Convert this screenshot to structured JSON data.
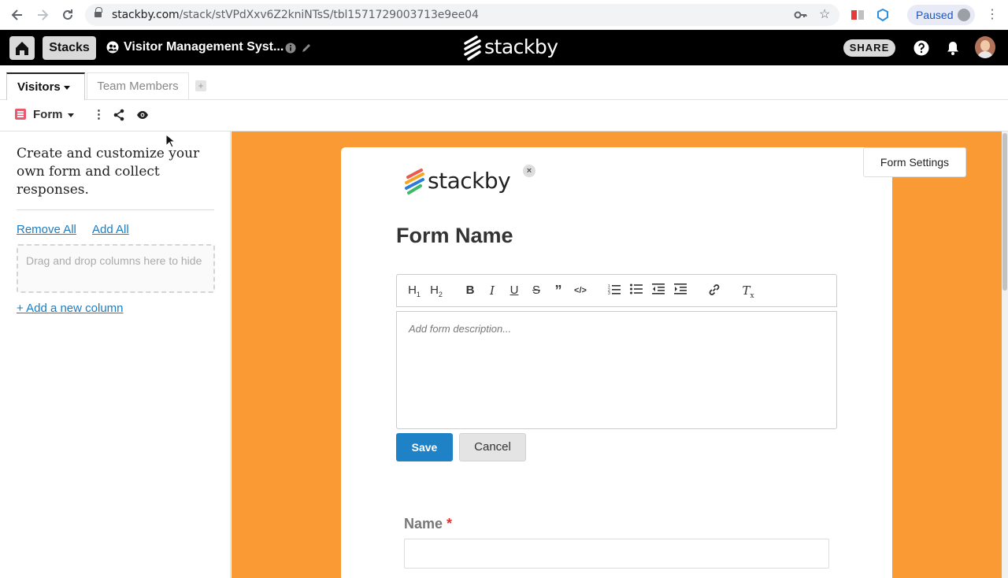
{
  "browser": {
    "url_host": "stackby.com",
    "url_path": "/stack/stVPdXxv6Z2kniNTsS/tbl1571729003713e9ee04",
    "profile_status": "Paused"
  },
  "header": {
    "stacks_label": "Stacks",
    "stack_title": "Visitor Management Syst...",
    "logo_text": "stackby",
    "share_label": "SHARE"
  },
  "tabs": [
    {
      "label": "Visitors",
      "active": true
    },
    {
      "label": "Team Members",
      "active": false
    }
  ],
  "view": {
    "name": "Form"
  },
  "left_panel": {
    "description": "Create and customize your own form and collect responses.",
    "remove_all": "Remove All",
    "add_all": "Add All",
    "dropzone_text": "Drag and drop columns here to hide",
    "add_column": "+ Add a new column"
  },
  "form": {
    "settings_label": "Form Settings",
    "logo_text": "stackby",
    "name": "Form Name",
    "description_placeholder": "Add form description...",
    "save_label": "Save",
    "cancel_label": "Cancel",
    "fields": [
      {
        "label": "Name",
        "required_mark": "*"
      }
    ],
    "toolbar": [
      "H1",
      "H2",
      "B",
      "I",
      "U",
      "S",
      "quote",
      "code",
      "ordered-list",
      "bullet-list",
      "outdent",
      "indent",
      "link",
      "clear-format"
    ]
  },
  "colors": {
    "canvas_bg": "#f99a35",
    "primary": "#1f82c6",
    "required": "#e0322d"
  }
}
